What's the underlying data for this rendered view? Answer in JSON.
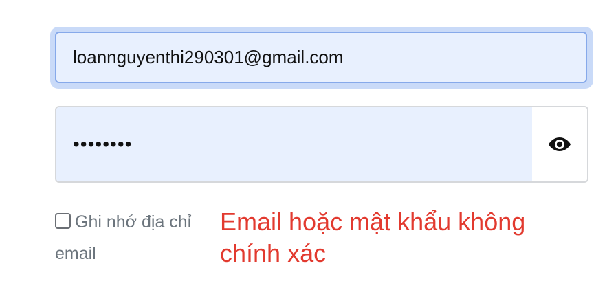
{
  "login_form": {
    "email": {
      "value": "loannguyenthi290301@gmail.com"
    },
    "password": {
      "masked_value": "••••••••"
    },
    "show_password_icon": "eye-icon",
    "remember_email": {
      "label": "Ghi nhớ địa chỉ email",
      "checked": false
    },
    "error_message": "Email hoặc mật khẩu không chính xác"
  },
  "colors": {
    "field_fill": "#e8f0fe",
    "focus_border": "#86a9ea",
    "focus_ring": "#c9daf8",
    "error": "#e23a2f",
    "muted_text": "#6c757d"
  }
}
